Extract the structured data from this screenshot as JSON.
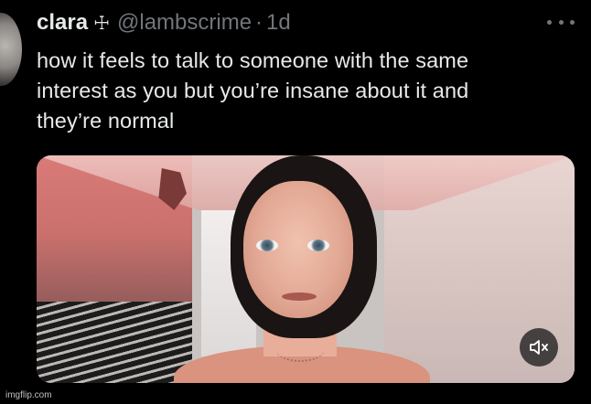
{
  "tweet": {
    "display_name": "clara",
    "name_symbol": "☩",
    "handle": "@lambscrime",
    "separator": "·",
    "time": "1d",
    "text": "how it feels to talk to someone with the same\ninterest as you but you’re insane about it and\nthey’re normal"
  },
  "media": {
    "type": "video",
    "mute_icon": "speaker-muted-icon"
  },
  "watermark": "imgflip.com",
  "colors": {
    "background": "#000000",
    "text_primary": "#e7e9ea",
    "text_secondary": "#71767b"
  }
}
